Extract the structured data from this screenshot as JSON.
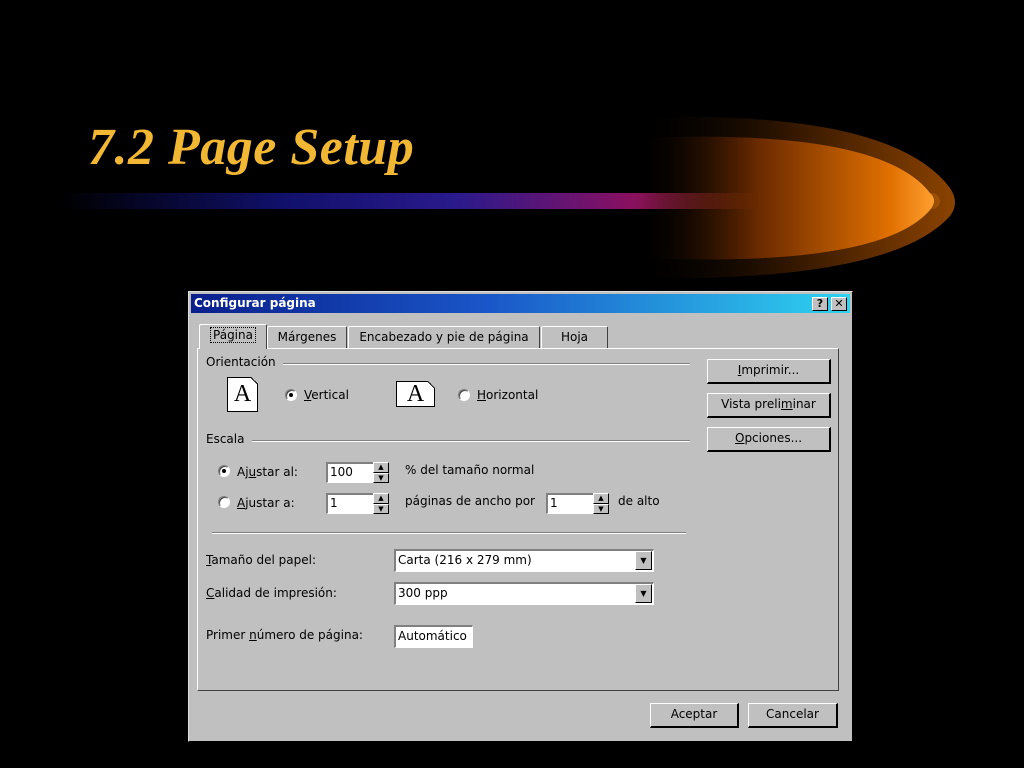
{
  "slide": {
    "title": "7.2 Page Setup"
  },
  "dialog": {
    "title": "Configurar página",
    "help_button": "?",
    "close_button": "✕",
    "tabs": [
      {
        "label": "Página",
        "active": true
      },
      {
        "label": "Márgenes",
        "active": false
      },
      {
        "label": "Encabezado y pie de página",
        "active": false
      },
      {
        "label": "Hoja",
        "active": false
      }
    ],
    "orientation": {
      "group_label": "Orientación",
      "icon_letter": "A",
      "vertical_label": "Vertical",
      "horizontal_label": "Horizontal",
      "selected": "vertical"
    },
    "scale": {
      "group_label": "Escala",
      "adjust_to_label": "Ajustar al:",
      "adjust_to_value": "100",
      "adjust_to_suffix": "% del tamaño normal",
      "fit_to_label": "Ajustar a:",
      "fit_width_value": "1",
      "fit_width_suffix": "páginas de ancho por",
      "fit_height_value": "1",
      "fit_height_suffix": "de alto",
      "selected": "adjust_to"
    },
    "paper_size": {
      "label": "Tamaño del papel:",
      "value": "Carta (216 x 279 mm)"
    },
    "print_quality": {
      "label": "Calidad de impresión:",
      "value": "300 ppp"
    },
    "first_page_number": {
      "label": "Primer número de página:",
      "value": "Automático"
    },
    "side_buttons": {
      "print": "Imprimir...",
      "preview": "Vista preliminar",
      "options": "Opciones..."
    },
    "footer_buttons": {
      "ok": "Aceptar",
      "cancel": "Cancelar"
    }
  },
  "colors": {
    "title_color": "#f2b733",
    "dialog_bg": "#c0c0c0",
    "titlebar_start": "#0a1f8c",
    "titlebar_end": "#2fd3f0"
  }
}
